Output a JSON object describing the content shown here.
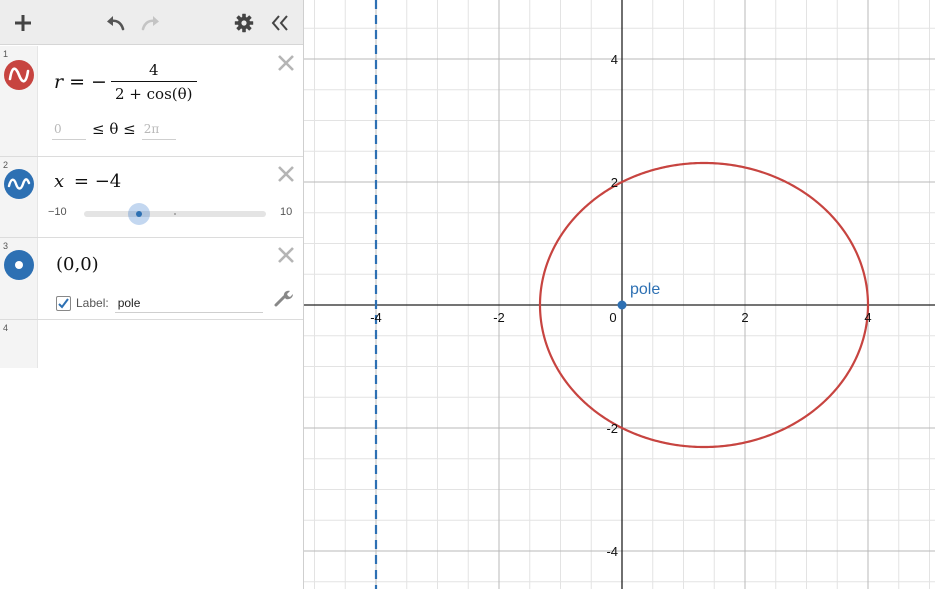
{
  "toolbar": {
    "add_icon": "plus-icon",
    "undo_icon": "undo-icon",
    "redo_icon": "redo-icon",
    "settings_icon": "gear-icon",
    "collapse_icon": "double-chevron-left-icon"
  },
  "expressions": [
    {
      "index": "1",
      "color": "#c74440",
      "icon": "polar-wave-icon",
      "lhs": "r",
      "eq": "= −",
      "numerator": "4",
      "denominator": "2 + cos(θ)",
      "domain_min": "0",
      "domain_middle": "≤ θ ≤",
      "domain_max": "2π"
    },
    {
      "index": "2",
      "color": "#2d70b3",
      "icon": "slider-wave-icon",
      "lhs": "x",
      "rhs": "= −4",
      "slider_min": "−10",
      "slider_max": "10",
      "slider_value": -4,
      "slider_range": [
        -10,
        10
      ]
    },
    {
      "index": "3",
      "color": "#2d70b3",
      "icon": "point-icon",
      "text": "(0,0)",
      "label_caption": "Label:",
      "label_value": "pole",
      "label_checked": true
    },
    {
      "index": "4"
    }
  ],
  "graph": {
    "x_ticks": [
      "-4",
      "-2",
      "0",
      "2",
      "4"
    ],
    "y_ticks": [
      "4",
      "2",
      "-2",
      "-4"
    ],
    "point_label": "pole",
    "grid": true,
    "line_x": -4,
    "line_style": "dashed",
    "polar_curve": "r = -4/(2+cos(θ))",
    "curve_color": "#c74440",
    "line_color": "#2d70b3",
    "point_color": "#2d70b3",
    "point": [
      0,
      0
    ]
  }
}
